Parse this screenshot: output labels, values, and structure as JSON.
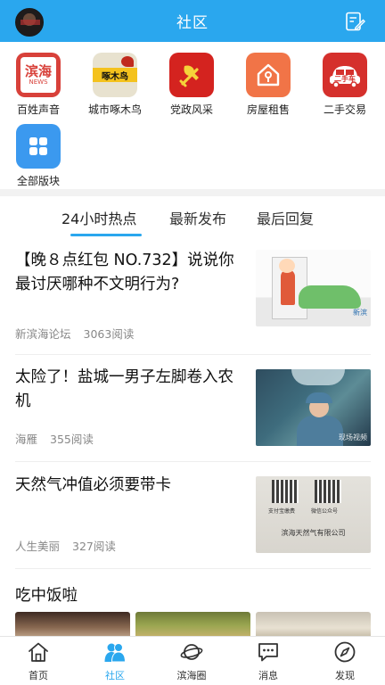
{
  "header": {
    "title": "社区"
  },
  "grid": {
    "items": [
      {
        "label": "百姓声音",
        "icon": "binhai-news-icon",
        "icon_text": "滨海",
        "icon_subtext": "NEWS"
      },
      {
        "label": "城市啄木鸟",
        "icon": "woodpecker-icon",
        "icon_text": "啄木鸟"
      },
      {
        "label": "党政风采",
        "icon": "party-emblem-icon"
      },
      {
        "label": "房屋租售",
        "icon": "house-icon"
      },
      {
        "label": "二手交易",
        "icon": "used-car-icon",
        "icon_text": "二手车"
      },
      {
        "label": "全部版块",
        "icon": "all-boards-icon"
      }
    ]
  },
  "tabs": [
    {
      "label": "24小时热点",
      "active": true
    },
    {
      "label": "最新发布",
      "active": false
    },
    {
      "label": "最后回复",
      "active": false
    }
  ],
  "posts": [
    {
      "title": "【晚８点红包 NO.732】说说你最讨厌哪种不文明行为?",
      "source": "新滨海论坛",
      "reads": "3063阅读",
      "thumb_logo": "新滨"
    },
    {
      "title": "太险了！盐城一男子左脚卷入农机",
      "source": "海雁",
      "reads": "355阅读",
      "thumb_watermark": "现场视频"
    },
    {
      "title": "天然气冲值必须要带卡",
      "source": "人生美丽",
      "reads": "327阅读",
      "thumb_caption_a": "支付宝缴费",
      "thumb_caption_b": "微信公众号",
      "thumb_line": "滨海天然气有限公司"
    }
  ],
  "section": {
    "title": "吃中饭啦"
  },
  "bottom_nav": [
    {
      "label": "首页",
      "icon": "home-icon",
      "active": false
    },
    {
      "label": "社区",
      "icon": "community-icon",
      "active": true
    },
    {
      "label": "滨海圈",
      "icon": "planet-icon",
      "active": false
    },
    {
      "label": "消息",
      "icon": "message-icon",
      "active": false
    },
    {
      "label": "发现",
      "icon": "compass-icon",
      "active": false
    }
  ],
  "colors": {
    "accent": "#2aa7ee",
    "header_bg": "#2aa7ee",
    "meta_text": "#888888"
  }
}
